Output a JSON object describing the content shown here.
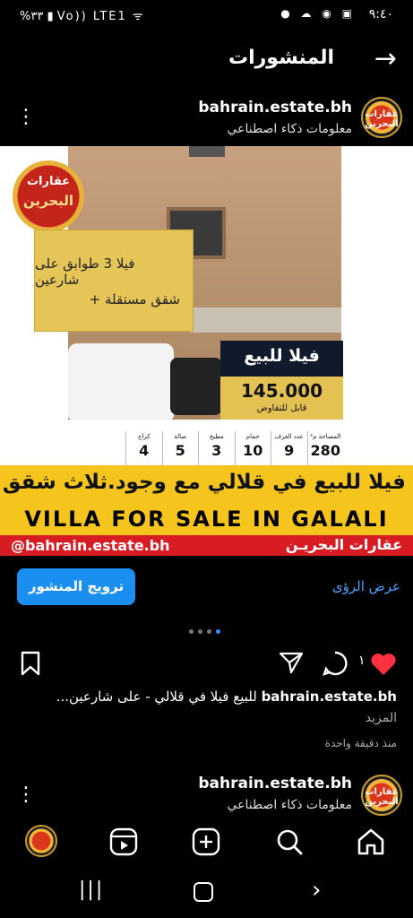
{
  "status_bar": {
    "time": "٩:٤٠",
    "battery": "%٣٣",
    "network": "Vo)) LTE1"
  },
  "header": {
    "title": "المنشورات"
  },
  "post1": {
    "username": "bahrain.estate.bh",
    "subtitle": "معلومات ذكاء اصطناعي",
    "avatar_text": "عقارات البحرين"
  },
  "image": {
    "logo_line1": "عقارات",
    "logo_line2": "البحرين",
    "gold_line1": "فيلا 3 طوابق على شارعين",
    "gold_line2": "+ شقق مستقلة",
    "price_title": "فيلا للبيع",
    "price_value": "145.000",
    "price_note": "قابل للتفاوض",
    "stats": [
      {
        "label": "المساحة م²",
        "value": "280"
      },
      {
        "label": "عدد الغرف",
        "value": "9"
      },
      {
        "label": "حمام",
        "value": "10"
      },
      {
        "label": "مطبخ",
        "value": "3"
      },
      {
        "label": "صالة",
        "value": "5"
      },
      {
        "label": "كراج",
        "value": "4"
      }
    ],
    "banner_ar": "فيلا للبيع في قلالي مع وجود.ثلاث شقق",
    "banner_en": "VILLA FOR SALE IN GALALI",
    "handle": "@bahrain.estate.bh",
    "brand": "عقارات البحريـن"
  },
  "promote_label": "ترويج المنشور",
  "insights_label": "عرض الرؤى",
  "like_count": "١",
  "caption": {
    "username": "bahrain.estate.bh",
    "text": "للبيع فيلا في قلالي -  على شارعين...",
    "more": "المزيد",
    "time": "منذ دقيقة واحدة"
  },
  "post2": {
    "username": "bahrain.estate.bh",
    "subtitle": "معلومات ذكاء اصطناعي"
  }
}
